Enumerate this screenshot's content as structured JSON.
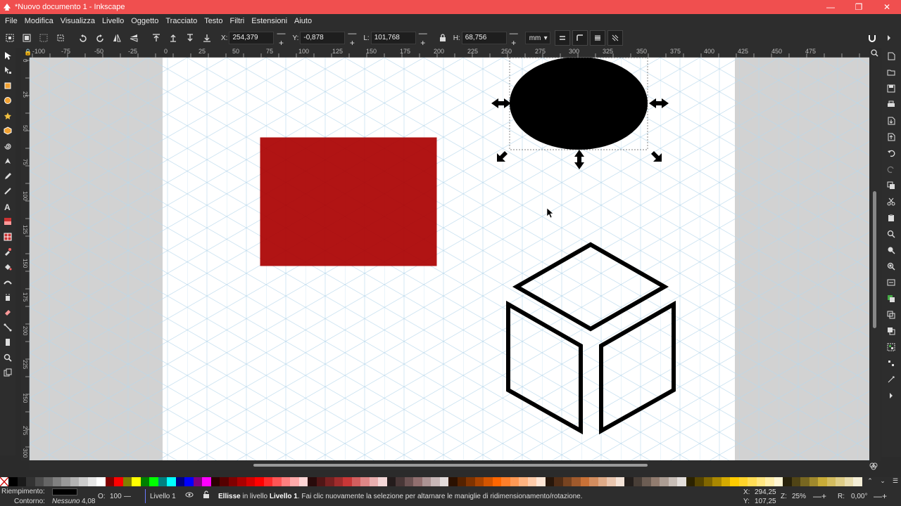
{
  "window": {
    "title": "*Nuovo documento 1 - Inkscape",
    "minimize": "—",
    "maximize": "❐",
    "close": "✕"
  },
  "menu": [
    "File",
    "Modifica",
    "Visualizza",
    "Livello",
    "Oggetto",
    "Tracciato",
    "Testo",
    "Filtri",
    "Estensioni",
    "Aiuto"
  ],
  "toolbar": {
    "x_label": "X:",
    "x_value": "254,379",
    "y_label": "Y:",
    "y_value": "-0,878",
    "w_label": "L:",
    "w_value": "101,768",
    "h_label": "H:",
    "h_value": "68,756",
    "unit": "mm",
    "plusminus": "—+"
  },
  "rulers": {
    "h_ticks": [
      "-100",
      "-75",
      "-50",
      "-25",
      "0",
      "25",
      "50",
      "75",
      "100",
      "125",
      "150",
      "175",
      "200",
      "225",
      "250",
      "275",
      "300",
      "325",
      "350",
      "375",
      "400",
      "425",
      "450",
      "475"
    ],
    "v_ticks": [
      "0",
      "25",
      "50",
      "75",
      "100",
      "125",
      "150",
      "175",
      "200",
      "225",
      "250",
      "275",
      "300"
    ]
  },
  "objects": {
    "rect_color": "#aa0000",
    "ellipse_color": "#000000"
  },
  "status": {
    "fill_label": "Riempimento:",
    "stroke_label": "Contorno:",
    "stroke_value": "Nessuno",
    "stroke_width": "4,08",
    "opacity_label": "O:",
    "opacity_value": "100",
    "opacity_dash": "—",
    "layer": "Livello 1",
    "msg_bold": "Ellisse",
    "msg_a": " in livello ",
    "msg_layer": "Livello 1",
    "msg_b": ". Fai clic nuovamente la selezione per altarnare le maniglie di ridimensionamento/rotazione.",
    "cursor_x_label": "X:",
    "cursor_x": "294,25",
    "cursor_y_label": "Y:",
    "cursor_y": "107,25",
    "zoom_label": "Z:",
    "zoom": "25%",
    "rotation_label": "R:",
    "rotation": "0,00°",
    "pm": "—+"
  },
  "palette": [
    "#000000",
    "#1a1a1a",
    "#333333",
    "#4d4d4d",
    "#666666",
    "#808080",
    "#999999",
    "#b3b3b3",
    "#cccccc",
    "#e6e6e6",
    "#ffffff",
    "#800000",
    "#ff0000",
    "#808000",
    "#ffff00",
    "#008000",
    "#00ff00",
    "#008080",
    "#00ffff",
    "#000080",
    "#0000ff",
    "#800080",
    "#ff00ff",
    "#2b0000",
    "#550000",
    "#800000",
    "#aa0000",
    "#d40000",
    "#ff0000",
    "#ff2a2a",
    "#ff5555",
    "#ff8080",
    "#ffaaaa",
    "#ffd5d5",
    "#280b0b",
    "#501616",
    "#782121",
    "#a02c2c",
    "#c83737",
    "#d35f5f",
    "#de8787",
    "#e9afaf",
    "#f4d7d7",
    "#241c1c",
    "#483737",
    "#6c5353",
    "#916f6f",
    "#ac9393",
    "#c8b7b7",
    "#e3dbdb",
    "#2b1100",
    "#552200",
    "#803300",
    "#aa4400",
    "#d45500",
    "#ff6600",
    "#ff7f2a",
    "#ff9955",
    "#ffb380",
    "#ffccaa",
    "#ffe6d5",
    "#28170b",
    "#502d16",
    "#784421",
    "#a05a2c",
    "#c87137",
    "#d38d5f",
    "#deaa87",
    "#e9c6af",
    "#f4e3d7",
    "#241f1c",
    "#483e37",
    "#6c5d53",
    "#917c6f",
    "#ac9d93",
    "#c8beb7",
    "#e3dedb",
    "#2b2200",
    "#554400",
    "#806600",
    "#aa8800",
    "#d4aa00",
    "#ffcc00",
    "#ffd42a",
    "#ffdd55",
    "#ffe680",
    "#ffeeaa",
    "#fff6d5",
    "#28220b",
    "#504416",
    "#786721",
    "#a0892c",
    "#c8ab37",
    "#d3bc5f",
    "#decd87",
    "#e9ddaf",
    "#f4eed7"
  ]
}
